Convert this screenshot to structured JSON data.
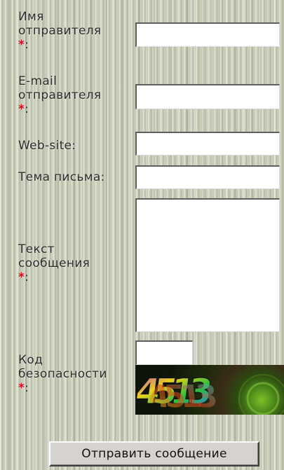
{
  "form": {
    "sender_name": {
      "label": [
        "Имя",
        "отправителя"
      ],
      "required_mark": "*",
      "suffix": ":",
      "value": ""
    },
    "sender_email": {
      "label": [
        "E-mail",
        "отправителя"
      ],
      "required_mark": "*",
      "suffix": ":",
      "value": ""
    },
    "website": {
      "label": "Web-site:",
      "value": ""
    },
    "subject": {
      "label": "Тема письма:",
      "value": ""
    },
    "message": {
      "label": [
        "Текст",
        "сообщения"
      ],
      "required_mark": "*",
      "suffix": ":",
      "value": ""
    },
    "security_code": {
      "label": [
        "Код",
        "безопасности"
      ],
      "required_mark": "*",
      "suffix": ":",
      "value": "",
      "captcha_text": "4513"
    },
    "submit_label": "Отправить сообщение"
  },
  "colors": {
    "required": "#e0001b",
    "background": "#c9cdb8"
  }
}
